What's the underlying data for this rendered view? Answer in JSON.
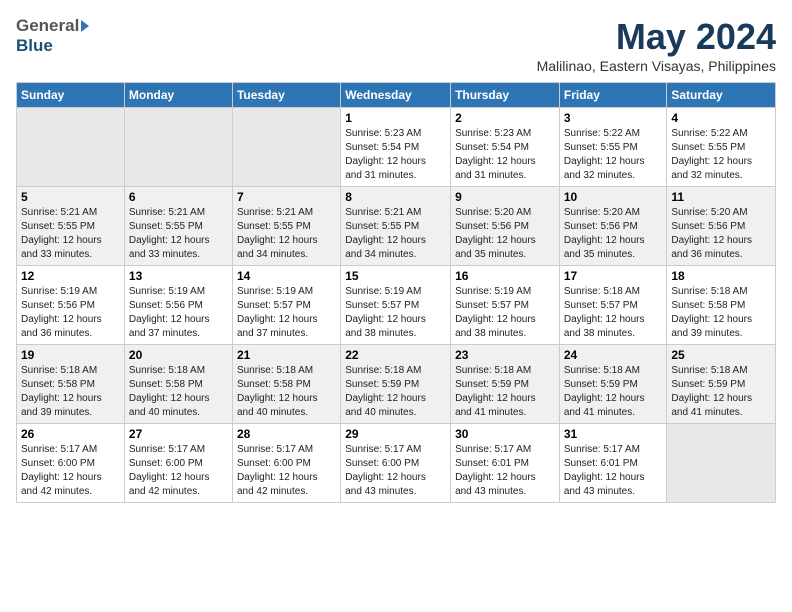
{
  "header": {
    "logo_general": "General",
    "logo_blue": "Blue",
    "month_title": "May 2024",
    "location": "Malilinao, Eastern Visayas, Philippines"
  },
  "days_of_week": [
    "Sunday",
    "Monday",
    "Tuesday",
    "Wednesday",
    "Thursday",
    "Friday",
    "Saturday"
  ],
  "weeks": [
    [
      {
        "day": "",
        "info": ""
      },
      {
        "day": "",
        "info": ""
      },
      {
        "day": "",
        "info": ""
      },
      {
        "day": "1",
        "info": "Sunrise: 5:23 AM\nSunset: 5:54 PM\nDaylight: 12 hours\nand 31 minutes."
      },
      {
        "day": "2",
        "info": "Sunrise: 5:23 AM\nSunset: 5:54 PM\nDaylight: 12 hours\nand 31 minutes."
      },
      {
        "day": "3",
        "info": "Sunrise: 5:22 AM\nSunset: 5:55 PM\nDaylight: 12 hours\nand 32 minutes."
      },
      {
        "day": "4",
        "info": "Sunrise: 5:22 AM\nSunset: 5:55 PM\nDaylight: 12 hours\nand 32 minutes."
      }
    ],
    [
      {
        "day": "5",
        "info": "Sunrise: 5:21 AM\nSunset: 5:55 PM\nDaylight: 12 hours\nand 33 minutes."
      },
      {
        "day": "6",
        "info": "Sunrise: 5:21 AM\nSunset: 5:55 PM\nDaylight: 12 hours\nand 33 minutes."
      },
      {
        "day": "7",
        "info": "Sunrise: 5:21 AM\nSunset: 5:55 PM\nDaylight: 12 hours\nand 34 minutes."
      },
      {
        "day": "8",
        "info": "Sunrise: 5:21 AM\nSunset: 5:55 PM\nDaylight: 12 hours\nand 34 minutes."
      },
      {
        "day": "9",
        "info": "Sunrise: 5:20 AM\nSunset: 5:56 PM\nDaylight: 12 hours\nand 35 minutes."
      },
      {
        "day": "10",
        "info": "Sunrise: 5:20 AM\nSunset: 5:56 PM\nDaylight: 12 hours\nand 35 minutes."
      },
      {
        "day": "11",
        "info": "Sunrise: 5:20 AM\nSunset: 5:56 PM\nDaylight: 12 hours\nand 36 minutes."
      }
    ],
    [
      {
        "day": "12",
        "info": "Sunrise: 5:19 AM\nSunset: 5:56 PM\nDaylight: 12 hours\nand 36 minutes."
      },
      {
        "day": "13",
        "info": "Sunrise: 5:19 AM\nSunset: 5:56 PM\nDaylight: 12 hours\nand 37 minutes."
      },
      {
        "day": "14",
        "info": "Sunrise: 5:19 AM\nSunset: 5:57 PM\nDaylight: 12 hours\nand 37 minutes."
      },
      {
        "day": "15",
        "info": "Sunrise: 5:19 AM\nSunset: 5:57 PM\nDaylight: 12 hours\nand 38 minutes."
      },
      {
        "day": "16",
        "info": "Sunrise: 5:19 AM\nSunset: 5:57 PM\nDaylight: 12 hours\nand 38 minutes."
      },
      {
        "day": "17",
        "info": "Sunrise: 5:18 AM\nSunset: 5:57 PM\nDaylight: 12 hours\nand 38 minutes."
      },
      {
        "day": "18",
        "info": "Sunrise: 5:18 AM\nSunset: 5:58 PM\nDaylight: 12 hours\nand 39 minutes."
      }
    ],
    [
      {
        "day": "19",
        "info": "Sunrise: 5:18 AM\nSunset: 5:58 PM\nDaylight: 12 hours\nand 39 minutes."
      },
      {
        "day": "20",
        "info": "Sunrise: 5:18 AM\nSunset: 5:58 PM\nDaylight: 12 hours\nand 40 minutes."
      },
      {
        "day": "21",
        "info": "Sunrise: 5:18 AM\nSunset: 5:58 PM\nDaylight: 12 hours\nand 40 minutes."
      },
      {
        "day": "22",
        "info": "Sunrise: 5:18 AM\nSunset: 5:59 PM\nDaylight: 12 hours\nand 40 minutes."
      },
      {
        "day": "23",
        "info": "Sunrise: 5:18 AM\nSunset: 5:59 PM\nDaylight: 12 hours\nand 41 minutes."
      },
      {
        "day": "24",
        "info": "Sunrise: 5:18 AM\nSunset: 5:59 PM\nDaylight: 12 hours\nand 41 minutes."
      },
      {
        "day": "25",
        "info": "Sunrise: 5:18 AM\nSunset: 5:59 PM\nDaylight: 12 hours\nand 41 minutes."
      }
    ],
    [
      {
        "day": "26",
        "info": "Sunrise: 5:17 AM\nSunset: 6:00 PM\nDaylight: 12 hours\nand 42 minutes."
      },
      {
        "day": "27",
        "info": "Sunrise: 5:17 AM\nSunset: 6:00 PM\nDaylight: 12 hours\nand 42 minutes."
      },
      {
        "day": "28",
        "info": "Sunrise: 5:17 AM\nSunset: 6:00 PM\nDaylight: 12 hours\nand 42 minutes."
      },
      {
        "day": "29",
        "info": "Sunrise: 5:17 AM\nSunset: 6:00 PM\nDaylight: 12 hours\nand 43 minutes."
      },
      {
        "day": "30",
        "info": "Sunrise: 5:17 AM\nSunset: 6:01 PM\nDaylight: 12 hours\nand 43 minutes."
      },
      {
        "day": "31",
        "info": "Sunrise: 5:17 AM\nSunset: 6:01 PM\nDaylight: 12 hours\nand 43 minutes."
      },
      {
        "day": "",
        "info": ""
      }
    ]
  ]
}
